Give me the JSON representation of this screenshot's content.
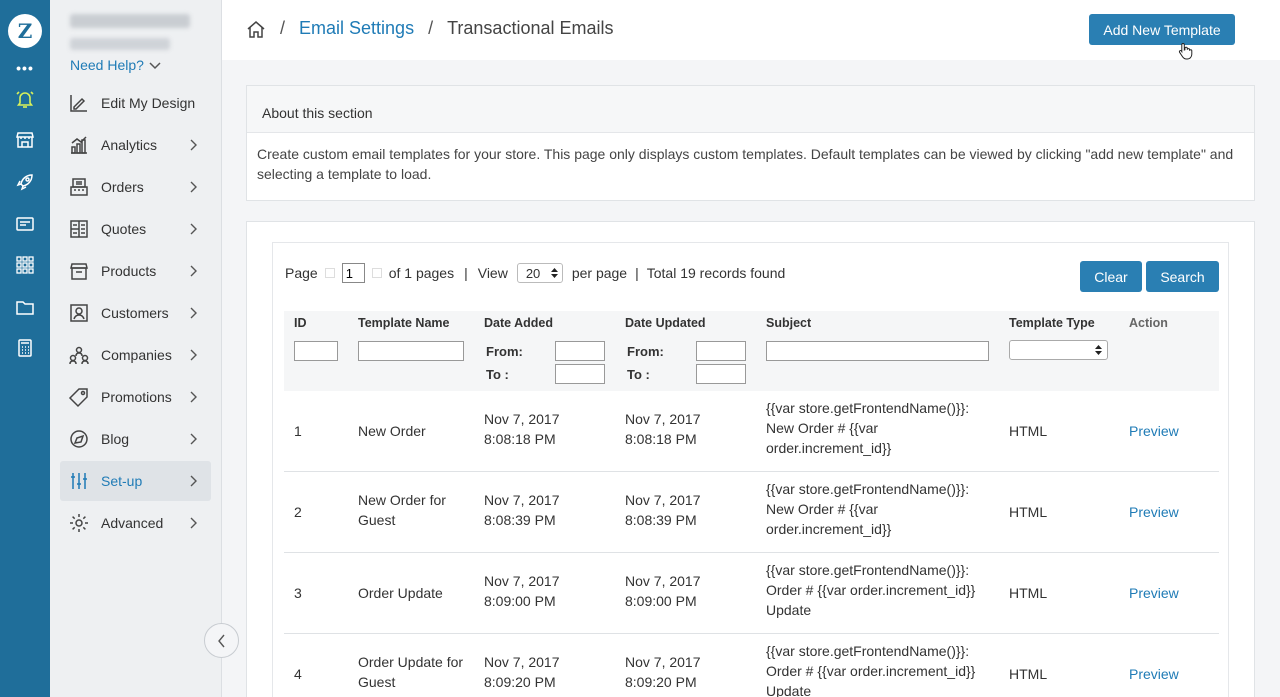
{
  "rail": {
    "logo": "Z",
    "more": "•••",
    "icons": [
      "bell-icon",
      "store-icon",
      "rocket-icon",
      "billing-icon",
      "apps-grid-icon",
      "folder-icon",
      "calculator-icon"
    ]
  },
  "nav": {
    "help_label": "Need Help?",
    "items": [
      {
        "label": "Edit My Design",
        "icon": "edit-design-icon",
        "chevron": false
      },
      {
        "label": "Analytics",
        "icon": "analytics-icon",
        "chevron": true
      },
      {
        "label": "Orders",
        "icon": "orders-icon",
        "chevron": true
      },
      {
        "label": "Quotes",
        "icon": "quotes-icon",
        "chevron": true
      },
      {
        "label": "Products",
        "icon": "products-icon",
        "chevron": true
      },
      {
        "label": "Customers",
        "icon": "customers-icon",
        "chevron": true
      },
      {
        "label": "Companies",
        "icon": "companies-icon",
        "chevron": true
      },
      {
        "label": "Promotions",
        "icon": "promotions-icon",
        "chevron": true
      },
      {
        "label": "Blog",
        "icon": "blog-icon",
        "chevron": true
      },
      {
        "label": "Set-up",
        "icon": "setup-icon",
        "chevron": true,
        "active": true
      },
      {
        "label": "Advanced",
        "icon": "advanced-icon",
        "chevron": true
      }
    ]
  },
  "breadcrumb": {
    "section": "Email Settings",
    "current": "Transactional Emails",
    "separator": "/"
  },
  "header": {
    "add_template_label": "Add New Template"
  },
  "about": {
    "title": "About this section",
    "text": "Create custom email templates for your store. This page only displays custom templates. Default templates can be viewed by clicking \"add new template\" and selecting a template to load."
  },
  "pager": {
    "page_label": "Page",
    "page_value": "1",
    "of_pages": "of 1 pages",
    "view_label": "View",
    "per_page_value": "20",
    "per_page_label": "per page",
    "total": "Total 19 records found",
    "divider": "|"
  },
  "buttons": {
    "clear": "Clear",
    "search": "Search"
  },
  "table": {
    "columns": {
      "id": "ID",
      "name": "Template Name",
      "date_added": "Date Added",
      "date_updated": "Date Updated",
      "subject": "Subject",
      "type": "Template Type",
      "action": "Action"
    },
    "filters": {
      "from": "From:",
      "to": "To :"
    },
    "rows": [
      {
        "id": "1",
        "name": "New Order",
        "date_added": "Nov 7, 2017 8:08:18 PM",
        "date_updated": "Nov 7, 2017 8:08:18 PM",
        "subject": "{{var store.getFrontendName()}}: New Order # {{var order.increment_id}}",
        "type": "HTML",
        "action": "Preview"
      },
      {
        "id": "2",
        "name": "New Order for Guest",
        "date_added": "Nov 7, 2017 8:08:39 PM",
        "date_updated": "Nov 7, 2017 8:08:39 PM",
        "subject": "{{var store.getFrontendName()}}: New Order # {{var order.increment_id}}",
        "type": "HTML",
        "action": "Preview"
      },
      {
        "id": "3",
        "name": "Order Update",
        "date_added": "Nov 7, 2017 8:09:00 PM",
        "date_updated": "Nov 7, 2017 8:09:00 PM",
        "subject": "{{var store.getFrontendName()}}: Order # {{var order.increment_id}} Update",
        "type": "HTML",
        "action": "Preview"
      },
      {
        "id": "4",
        "name": "Order Update for Guest",
        "date_added": "Nov 7, 2017 8:09:20 PM",
        "date_updated": "Nov 7, 2017 8:09:20 PM",
        "subject": "{{var store.getFrontendName()}}: Order # {{var order.increment_id}} Update",
        "type": "HTML",
        "action": "Preview"
      }
    ]
  },
  "colors": {
    "rail": "#1f6e9a",
    "accent": "#2a7fb3",
    "link": "#1f7bb6"
  }
}
